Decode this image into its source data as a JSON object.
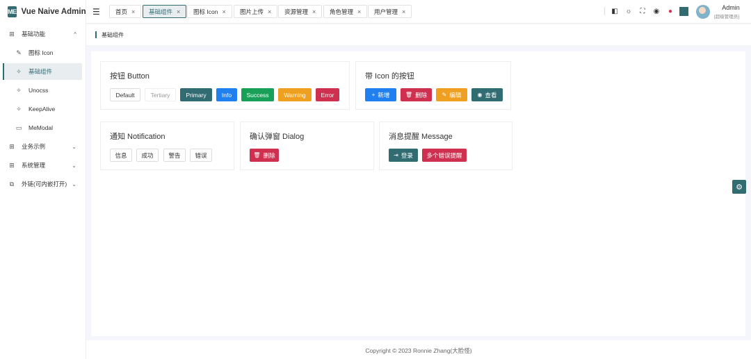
{
  "app": {
    "logo": "ME",
    "title": "Vue Naive Admin"
  },
  "sidebar": {
    "items": [
      {
        "icon": "grid-icon",
        "glyph": "⊞",
        "label": "基础功能",
        "chevron": "^"
      },
      {
        "icon": "feather-icon",
        "glyph": "✎",
        "label": "图标 Icon"
      },
      {
        "icon": "sparkle-icon",
        "glyph": "✧",
        "label": "基础组件"
      },
      {
        "icon": "sparkle-icon",
        "glyph": "✧",
        "label": "Unocss"
      },
      {
        "icon": "sparkle-icon",
        "glyph": "✧",
        "label": "KeepAlive"
      },
      {
        "icon": "window-icon",
        "glyph": "▭",
        "label": "MeModal"
      },
      {
        "icon": "grid-icon",
        "glyph": "⊞",
        "label": "业务示例",
        "chevron": "⌄"
      },
      {
        "icon": "grid-icon",
        "glyph": "⊞",
        "label": "系统管理",
        "chevron": "⌄"
      },
      {
        "icon": "external-link-icon",
        "glyph": "⧉",
        "label": "外链(可内嵌打开)",
        "chevron": "⌄"
      }
    ]
  },
  "topbar": {
    "fold_icon": "☰",
    "tabs": [
      {
        "label": "首页",
        "close": "×"
      },
      {
        "label": "基础组件",
        "close": "×"
      },
      {
        "label": "图标 Icon",
        "close": "×"
      },
      {
        "label": "图片上传",
        "close": "×"
      },
      {
        "label": "资源管理",
        "close": "×"
      },
      {
        "label": "角色管理",
        "close": "×"
      },
      {
        "label": "用户管理",
        "close": "×"
      }
    ],
    "icons": [
      {
        "name": "book-icon",
        "glyph": "◧"
      },
      {
        "name": "sun-icon",
        "glyph": "☼"
      },
      {
        "name": "fullscreen-icon",
        "glyph": "⛶"
      },
      {
        "name": "github-icon",
        "glyph": "◉"
      },
      {
        "name": "gitee-icon",
        "glyph": "●"
      }
    ],
    "theme_color": "#316c72",
    "user": {
      "name": "Admin",
      "role": "[超级管理员]"
    }
  },
  "breadcrumb": "基础组件",
  "cards": {
    "button": {
      "title": "按钮 Button",
      "buttons": [
        "Default",
        "Tertiary",
        "Primary",
        "Info",
        "Success",
        "Warning",
        "Error"
      ]
    },
    "icon_buttons": {
      "title": "带 Icon 的按钮",
      "buttons": [
        {
          "icon": "plus-icon",
          "glyph": "+",
          "label": "新增"
        },
        {
          "icon": "trash-icon",
          "glyph": "🗑",
          "label": "删除"
        },
        {
          "icon": "pencil-icon",
          "glyph": "✎",
          "label": "编辑"
        },
        {
          "icon": "eye-icon",
          "glyph": "◉",
          "label": "查看"
        }
      ]
    },
    "notification": {
      "title": "通知 Notification",
      "buttons": [
        "信息",
        "成功",
        "警告",
        "错误"
      ]
    },
    "dialog": {
      "title": "确认弹窗 Dialog",
      "button": {
        "icon": "trash-icon",
        "glyph": "🗑",
        "label": "删除"
      }
    },
    "message": {
      "title": "消息提醒 Message",
      "buttons": [
        {
          "icon": "login-icon",
          "glyph": "⇥",
          "label": "登录"
        },
        {
          "label": "多个错误提醒"
        }
      ]
    }
  },
  "colors": {
    "primary": "#316c72",
    "info": "#2080f0",
    "success": "#18a058",
    "warning": "#f0a020",
    "error": "#d03050"
  },
  "footer": "Copyright © 2023 Ronnie Zhang(大脸怪)",
  "settings_icon": "⚙"
}
